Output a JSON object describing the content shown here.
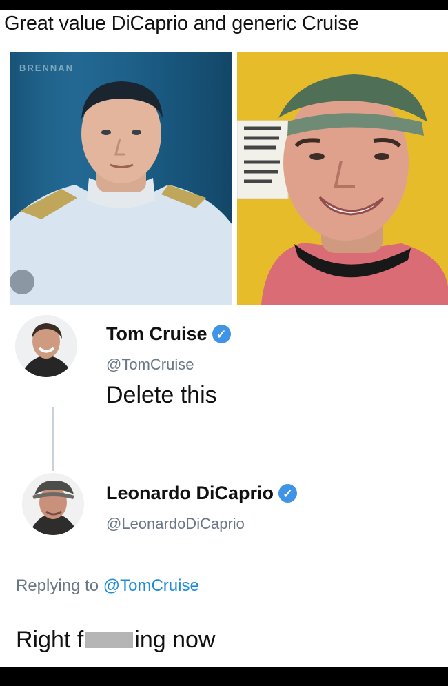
{
  "meme": {
    "caption": "Great value DiCaprio and generic Cruise",
    "photo_left": {
      "watermark": "BRENNAN"
    }
  },
  "tweet_1": {
    "display_name": "Tom Cruise",
    "handle": "@TomCruise",
    "text": "Delete this",
    "verified_icon": "verified-badge-icon"
  },
  "tweet_2": {
    "display_name": "Leonardo DiCaprio",
    "handle": "@LeonardoDiCaprio",
    "replying_prefix": "Replying to",
    "replying_to": "@TomCruise",
    "text_before": "Right f",
    "text_after": "ing now",
    "verified_icon": "verified-badge-icon"
  },
  "colors": {
    "verified": "#3f94e5",
    "handle_gray": "#6b7785",
    "mention_blue": "#1d8bdc"
  }
}
